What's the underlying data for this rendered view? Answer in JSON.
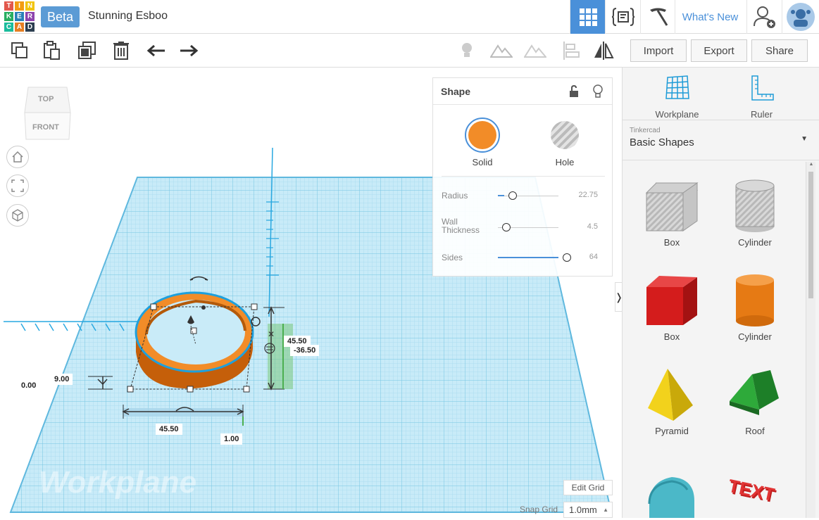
{
  "app": {
    "logo_letters": [
      "T",
      "I",
      "N",
      "K",
      "E",
      "R",
      "C",
      "A",
      "D"
    ],
    "logo_colors": [
      "#e2574c",
      "#f39c12",
      "#f1c40f",
      "#27ae60",
      "#2980b9",
      "#8e44ad",
      "#1abc9c",
      "#e67e22",
      "#2c3e50"
    ],
    "beta_label": "Beta",
    "project_title": "Stunning Esboo",
    "whats_new": "What's New"
  },
  "toolbar": {
    "import_label": "Import",
    "export_label": "Export",
    "share_label": "Share"
  },
  "viewcube": {
    "top": "TOP",
    "front": "FRONT"
  },
  "workplane": {
    "watermark": "Workplane",
    "edit_grid": "Edit Grid",
    "snap_grid_label": "Snap Grid",
    "snap_grid_value": "1.0mm"
  },
  "dimensions": {
    "height_label": "9.00",
    "elevation_label": "0.00",
    "width_label": "45.50",
    "length_label": "45.50",
    "y_offset_label": "-36.50",
    "x_offset_label": "1.00"
  },
  "shape_panel": {
    "title": "Shape",
    "solid_label": "Solid",
    "hole_label": "Hole",
    "solid_color": "#f28c28",
    "params": [
      {
        "label": "Radius",
        "value": "22.75",
        "level": 0.1
      },
      {
        "label": "Wall Thickness",
        "value": "4.5",
        "level": 0.0
      },
      {
        "label": "Sides",
        "value": "64",
        "level": 1.0
      }
    ]
  },
  "right_panel": {
    "workplane_label": "Workplane",
    "ruler_label": "Ruler",
    "library_source": "Tinkercad",
    "library_name": "Basic Shapes",
    "shapes": [
      {
        "label": "Box"
      },
      {
        "label": "Cylinder"
      },
      {
        "label": "Box"
      },
      {
        "label": "Cylinder"
      },
      {
        "label": "Pyramid"
      },
      {
        "label": "Roof"
      },
      {
        "label": ""
      },
      {
        "label": ""
      }
    ]
  }
}
